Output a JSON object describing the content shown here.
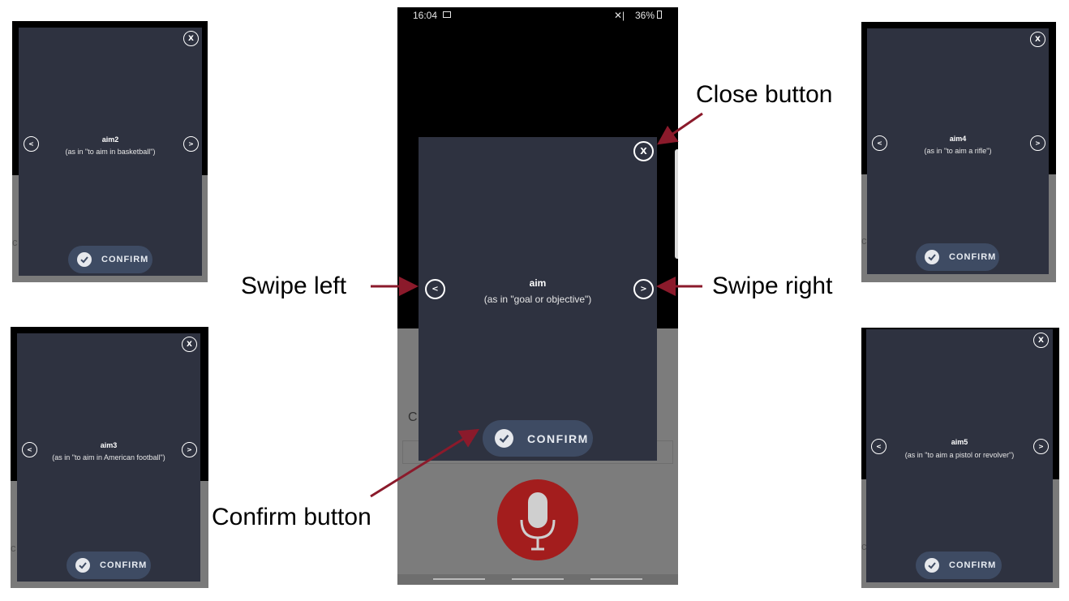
{
  "main": {
    "status_time": "16:04",
    "status_right": "36%",
    "word": "aim",
    "gloss": "(as in \"goal or objective\")",
    "confirm_label": "CONFIRM",
    "close_glyph": "X",
    "prev_glyph": "<",
    "next_glyph": ">",
    "bg_ghost_text": "C",
    "mic_color": "#a31d1d"
  },
  "thumbs": [
    {
      "word": "aim2",
      "gloss": "(as in \"to aim in basketball\")",
      "confirm_label": "CONFIRM",
      "close_glyph": "X",
      "prev_glyph": "<",
      "next_glyph": ">",
      "ghost": "c"
    },
    {
      "word": "aim3",
      "gloss": "(as in \"to aim in American football\")",
      "confirm_label": "CONFIRM",
      "close_glyph": "X",
      "prev_glyph": "<",
      "next_glyph": ">",
      "ghost": "c"
    },
    {
      "word": "aim4",
      "gloss": "(as in \"to aim a rifle\")",
      "confirm_label": "CONFIRM",
      "close_glyph": "X",
      "prev_glyph": "<",
      "next_glyph": ">",
      "ghost": "c"
    },
    {
      "word": "aim5",
      "gloss": "(as in \"to aim a pistol or revolver\")",
      "confirm_label": "CONFIRM",
      "close_glyph": "X",
      "prev_glyph": "<",
      "next_glyph": ">",
      "ghost": "c"
    }
  ],
  "annotations": {
    "close": "Close button",
    "swipe_left": "Swipe left",
    "swipe_right": "Swipe right",
    "confirm": "Confirm button"
  },
  "colors": {
    "card": "#2e3240",
    "confirm_pill": "#3e4b63",
    "arrow": "#8b1a2b"
  },
  "icons": [
    "close-icon",
    "chevron-left-icon",
    "chevron-right-icon",
    "check-icon",
    "microphone-icon",
    "image-icon",
    "battery-icon"
  ]
}
